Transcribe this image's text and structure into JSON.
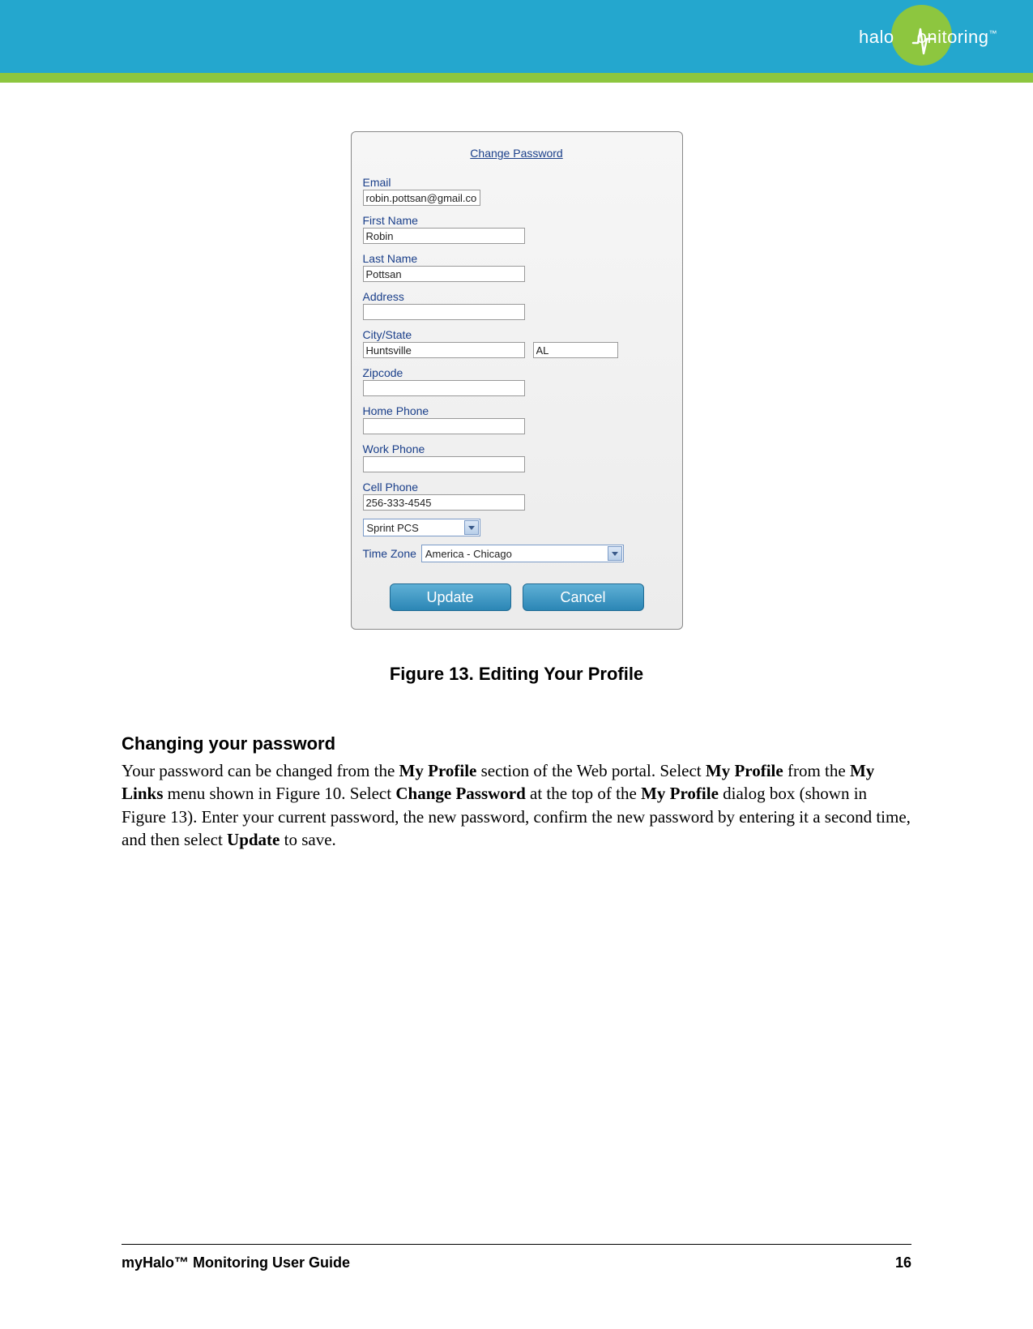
{
  "header": {
    "logo_text_1": "halo",
    "logo_text_2": "onitoring",
    "logo_tm": "™"
  },
  "form": {
    "change_password_link": "Change Password",
    "email_label": "Email",
    "email_value": "robin.pottsan@gmail.co",
    "first_name_label": "First Name",
    "first_name_value": "Robin",
    "last_name_label": "Last Name",
    "last_name_value": "Pottsan",
    "address_label": "Address",
    "address_value": "",
    "citystate_label": "City/State",
    "city_value": "Huntsville",
    "state_value": "AL",
    "zipcode_label": "Zipcode",
    "zipcode_value": "",
    "home_phone_label": "Home Phone",
    "home_phone_value": "",
    "work_phone_label": "Work Phone",
    "work_phone_value": "",
    "cell_phone_label": "Cell Phone",
    "cell_phone_value": "256-333-4545",
    "carrier_value": "Sprint PCS",
    "timezone_label": "Time Zone",
    "timezone_value": "America - Chicago",
    "update_button": "Update",
    "cancel_button": "Cancel"
  },
  "figure_caption": "Figure 13. Editing Your Profile",
  "section_heading": "Changing your password",
  "body_text_parts": {
    "p1a": "Your password can be changed from the ",
    "p1b": "My Profile",
    "p1c": " section of the Web portal. Select ",
    "p1d": "My Profile",
    "p1e": " from the ",
    "p1f": "My Links",
    "p1g": " menu shown in Figure 10. Select ",
    "p1h": "Change Password",
    "p1i": " at the top of the ",
    "p1j": "My Profile",
    "p1k": " dialog box (shown in Figure 13). Enter your current password, the new password, confirm the new password by entering it a second time, and then select ",
    "p1l": "Update",
    "p1m": " to save."
  },
  "footer": {
    "title": "myHalo™ Monitoring User Guide",
    "page": "16"
  }
}
